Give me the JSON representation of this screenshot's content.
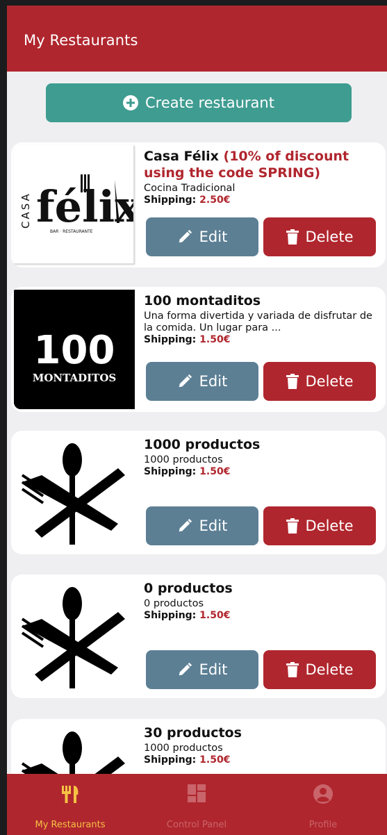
{
  "header": {
    "title": "My Restaurants"
  },
  "create_button": {
    "label": "Create restaurant",
    "icon": "plus-circle-icon"
  },
  "restaurants": [
    {
      "name": "Casa Félix",
      "discount": "(10% of discount using the code SPRING)",
      "description": "Cocina Tradicional",
      "shipping_label": "Shipping:",
      "shipping_price": "2.50€",
      "logo": {
        "casa": "CASA",
        "main": "félix",
        "sub": "BAR · RESTAURANTE"
      }
    },
    {
      "name": "100 montaditos",
      "discount": "",
      "description": "Una forma divertida y variada de disfrutar de la comida. Un lugar para ...",
      "shipping_label": "Shipping:",
      "shipping_price": "1.50€",
      "logo": {
        "number": "100",
        "word": "MONTADITOS"
      }
    },
    {
      "name": "1000 productos",
      "discount": "",
      "description": "1000 productos",
      "shipping_label": "Shipping:",
      "shipping_price": "1.50€"
    },
    {
      "name": "0 productos",
      "discount": "",
      "description": "0 productos",
      "shipping_label": "Shipping:",
      "shipping_price": "1.50€"
    },
    {
      "name": "30 productos",
      "discount": "",
      "description": "1000 productos",
      "shipping_label": "Shipping:",
      "shipping_price": "1.50€"
    }
  ],
  "actions": {
    "edit_label": "Edit",
    "delete_label": "Delete"
  },
  "tabbar": {
    "items": [
      {
        "label": "My Restaurants",
        "icon": "utensils-icon",
        "active": true
      },
      {
        "label": "Control Panel",
        "icon": "dashboard-icon",
        "active": false
      },
      {
        "label": "Profile",
        "icon": "user-circle-icon",
        "active": false
      }
    ]
  },
  "colors": {
    "primary": "#b0262e",
    "create": "#3f9c91",
    "edit": "#5c7f94",
    "active_tab": "#f5c244",
    "inactive_tab": "#c9646a"
  }
}
